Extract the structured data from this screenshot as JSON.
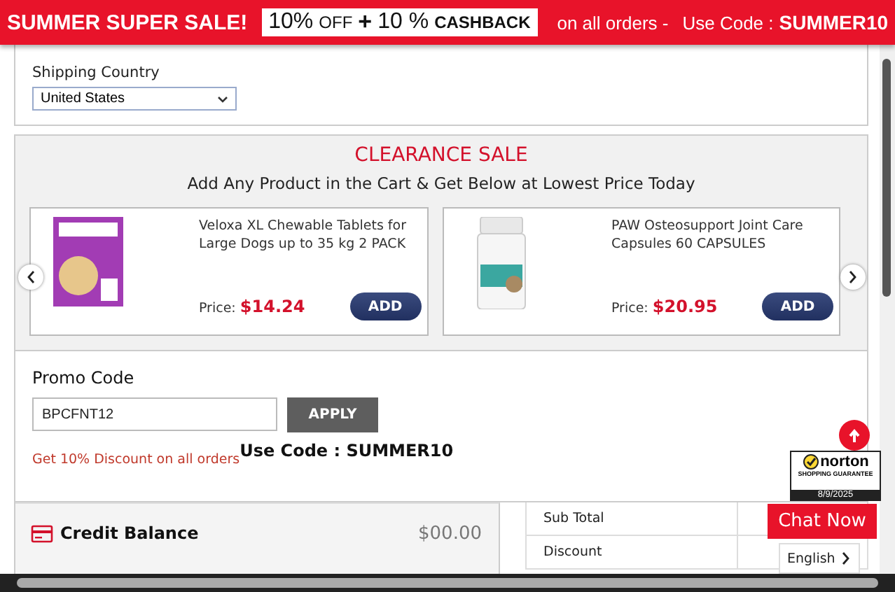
{
  "banner": {
    "title": "SUMMER SUPER SALE!",
    "offer_pct": "10%",
    "offer_off": "OFF",
    "plus": "+",
    "cashback_pct": "10 %",
    "cashback": "CASHBACK",
    "tail": "on all orders -",
    "code_label": "Use Code :",
    "code": "SUMMER10"
  },
  "shipping": {
    "label": "Shipping Country",
    "value": "United States"
  },
  "clearance": {
    "title": "CLEARANCE SALE",
    "subtitle": "Add Any Product in the Cart & Get Below at Lowest Price Today",
    "products": [
      {
        "name": "Veloxa XL Chewable Tablets for Large Dogs up to 35 kg 2 PACK",
        "price_label": "Price:",
        "price": "$14.24",
        "button": "ADD"
      },
      {
        "name": "PAW Osteosupport Joint Care Capsules 60 CAPSULES",
        "price_label": "Price:",
        "price": "$20.95",
        "button": "ADD"
      }
    ]
  },
  "promo": {
    "title": "Promo Code",
    "value": "BPCFNT12",
    "button": "APPLY",
    "offer": "Get 10% Discount on all orders",
    "code_note": "Use Code : SUMMER10"
  },
  "summary": {
    "credit_label": "Credit Balance",
    "credit_value": "$00.00",
    "rows": [
      {
        "label": "Sub Total"
      },
      {
        "label": "Discount"
      }
    ]
  },
  "norton": {
    "brand": "norton",
    "tagline": "SHOPPING GUARANTEE",
    "date": "8/9/2025"
  },
  "chat": {
    "label": "Chat Now"
  },
  "language": {
    "value": "English"
  }
}
